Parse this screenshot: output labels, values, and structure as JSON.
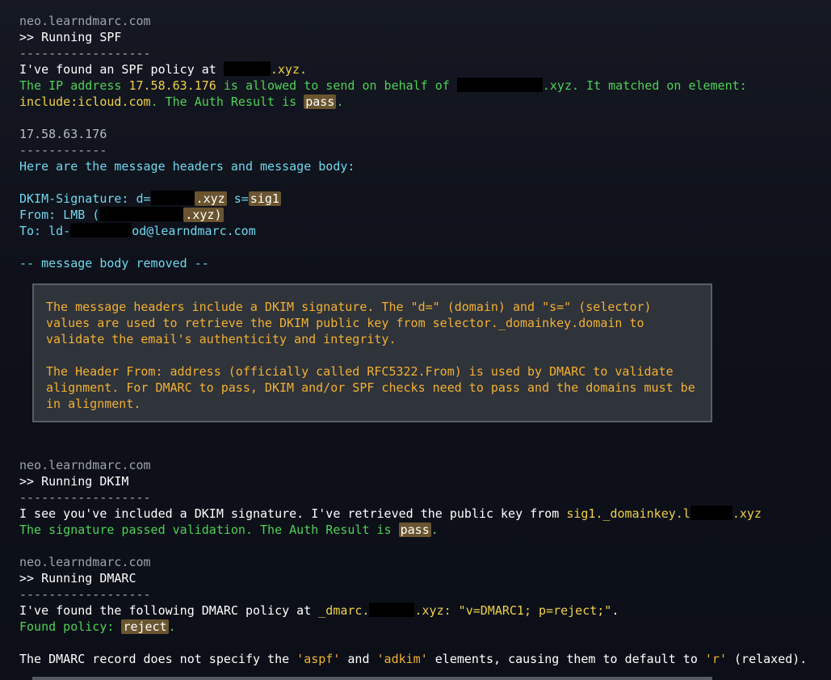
{
  "spf": {
    "host": "neo.learndmarc.com",
    "command": ">> Running SPF",
    "rule": "------------------",
    "found_prefix": "I've found an SPF policy at ",
    "found_suffix": ".xyz.",
    "ip_prefix": "The IP address ",
    "ip": "17.58.63.176",
    "ip_mid": " is allowed to send on behalf of ",
    "ip_suffix": ".xyz. It matched on element:",
    "include": "include:icloud.com",
    "auth_text": ". The Auth Result is ",
    "auth_result": "pass",
    "period": "."
  },
  "ip_block": {
    "ip": "17.58.63.176",
    "rule": "------------",
    "header_line": "Here are the message headers and message body:"
  },
  "headers": {
    "dkim_prefix": "DKIM-Signature: d=",
    "dkim_domain_suffix": ".xyz",
    "dkim_selector_prefix": " s=",
    "dkim_selector": "sig1",
    "from_prefix": "From: LMB (",
    "from_suffix": ".xyz)",
    "to_prefix": "To: ld-",
    "to_suffix": "od@learndmarc.com",
    "body_removed": "-- message body removed --"
  },
  "info_box": {
    "para1_line1": "The message headers include a DKIM signature. The \"d=\" (domain) and \"s=\" (selector)",
    "para1_line2": "values are used to retrieve the DKIM public key from selector._domainkey.domain to",
    "para1_line3": "validate the email's authenticity and integrity.",
    "para2_line1": "The Header From: address (officially called RFC5322.From) is used by DMARC to validate",
    "para2_line2": "alignment. For DMARC to pass, DKIM and/or SPF checks need to pass and the domains must be",
    "para2_line3": "in alignment."
  },
  "dkim": {
    "host": "neo.learndmarc.com",
    "command": ">> Running DKIM",
    "rule": "------------------",
    "text_prefix": "I see you've included a DKIM signature. I've retrieved the public key from ",
    "key_prefix": "sig1._domainkey.l",
    "key_suffix": ".xyz",
    "passed_text": "The signature passed validation. The Auth Result is ",
    "auth_result": "pass",
    "period": "."
  },
  "dmarc": {
    "host": "neo.learndmarc.com",
    "command": ">> Running DMARC",
    "rule": "------------------",
    "found_prefix": "I've found the following DMARC policy at ",
    "dmarc_prefix": "_dmarc.",
    "dmarc_suffix": ".xyz",
    "colon": ": ",
    "record": "\"v=DMARC1; p=reject;\"",
    "period": ".",
    "policy_label": "Found policy: ",
    "policy": "reject",
    "note_prefix": "The DMARC record does not specify the ",
    "aspf": "'aspf'",
    "and": " and ",
    "adkim": "'adkim'",
    "note_mid": " elements, causing them to default to ",
    "default_value": "'r'",
    "note_suffix": " (relaxed)."
  },
  "colors": {
    "background": "#0f121c",
    "green": "#4fd058",
    "yellow": "#f0d04a",
    "cyan": "#6fd8ee",
    "orange": "#f2b133",
    "highlight": "#6a5530",
    "box": "#2f333a"
  }
}
